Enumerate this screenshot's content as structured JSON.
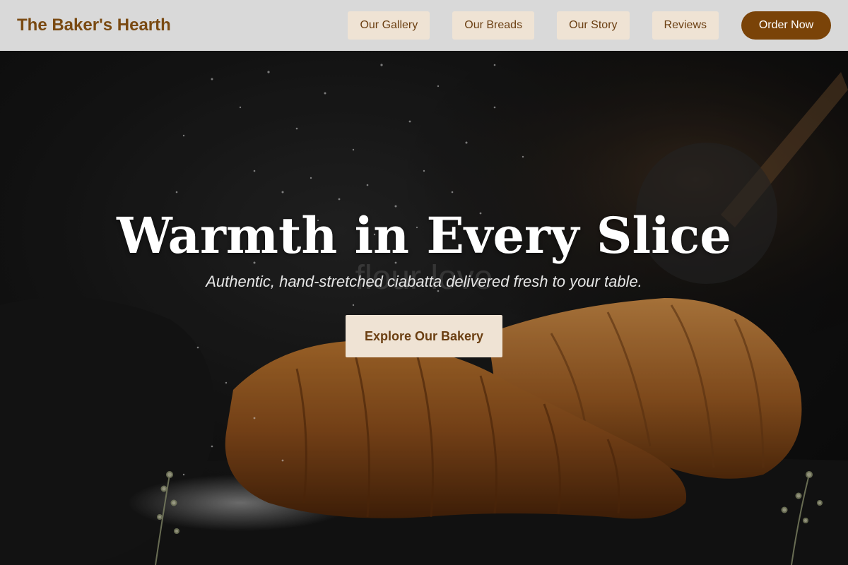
{
  "brand": {
    "name": "The Baker's Hearth",
    "color": "#7a4a12"
  },
  "nav": {
    "items": [
      {
        "label": "Our Gallery"
      },
      {
        "label": "Our Breads"
      },
      {
        "label": "Our Story"
      },
      {
        "label": "Reviews"
      }
    ],
    "order_button": "Order Now"
  },
  "hero": {
    "title": "Warmth in Every Slice",
    "subtitle": "Authentic, hand-stretched ciabatta delivered fresh to your table.",
    "ghost_text": "flour love",
    "cta": "Explore Our Bakery",
    "image": "croissants-flour-dusting-photo"
  },
  "colors": {
    "nav_background": "#d9d9d9",
    "nav_button_bg": "#efe3d4",
    "nav_button_text": "#6b3f12",
    "order_button_bg": "#7a4308",
    "hero_text": "#ffffff"
  }
}
